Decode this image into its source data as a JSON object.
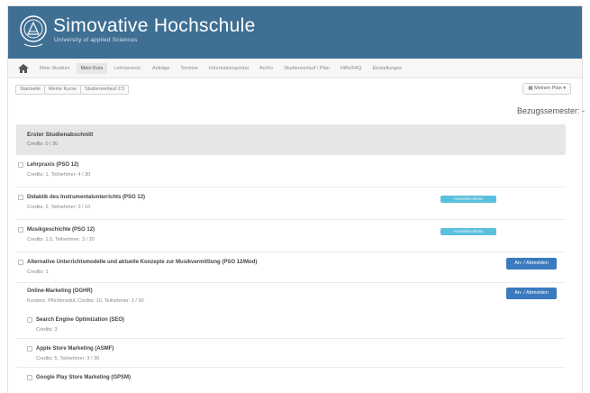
{
  "brand": {
    "title": "Simovative Hochschule",
    "subtitle": "University of applied Sciences"
  },
  "topnav": {
    "items": [
      {
        "label": "Mein Studium",
        "active": false
      },
      {
        "label": "Mein Kurs",
        "active": true
      },
      {
        "label": "Lehrveranst.",
        "active": false
      },
      {
        "label": "Anträge",
        "active": false
      },
      {
        "label": "Termine",
        "active": false
      },
      {
        "label": "Informationsportal",
        "active": false
      },
      {
        "label": "Archiv",
        "active": false
      },
      {
        "label": "Studienverlauf / Plan",
        "active": false
      },
      {
        "label": "Hilfe/FAQ",
        "active": false
      },
      {
        "label": "Einstellungen",
        "active": false
      }
    ]
  },
  "breadcrumbs": [
    "Startseite",
    "Meine Kurse",
    "Studienverlauf 2.5"
  ],
  "plan_button": "Meinen Plan",
  "semester_label": "Bezugssemester: -",
  "section": {
    "title": "Erster Studienabschnitt",
    "credits": "Credits: 0 / 30"
  },
  "modules": [
    {
      "title": "Lehrpraxis (PSO 12)",
      "meta": "Credits: 1, Teilnehmer: 4 / 30",
      "badge": "",
      "button": ""
    },
    {
      "title": "Didaktik des Instrumentalunterrichts (PSO 12)",
      "meta": "Credits: 2, Teilnehmer: 3 / 10",
      "badge": "Anmeldeschluss",
      "button": ""
    },
    {
      "title": "Musikgeschichte (PSO 12)",
      "meta": "Credits: 1.5, Teilnehmer: 3 / 30",
      "badge": "Anmeldeschluss",
      "button": ""
    },
    {
      "title": "Alternative Unterrichtsmodelle und aktuelle Konzepte zur Musikvermittlung (PSO 12/Mod)",
      "meta": "Credits: 1",
      "badge": "",
      "button": "An- / Abmelden"
    },
    {
      "title": "Online-Marketing (OGHR)",
      "meta": "Kursbez. Pflichtmodul, Credits: 10, Teilnehmer: 3 / 30",
      "badge": "",
      "button": "An- / Abmelden"
    }
  ],
  "submodules": [
    {
      "title": "Search Engine Optimization (SEO)",
      "meta": "Credits: 3"
    },
    {
      "title": "Apple Store Marketing (ASMF)",
      "meta": "Credits: 5, Teilnehmer: 3 / 30"
    },
    {
      "title": "Google Play Store Marketing (GPSM)",
      "meta": ""
    }
  ],
  "colors": {
    "header": "#3f6f93",
    "primary_button": "#3a7bbf",
    "badge": "#5bc0de"
  }
}
